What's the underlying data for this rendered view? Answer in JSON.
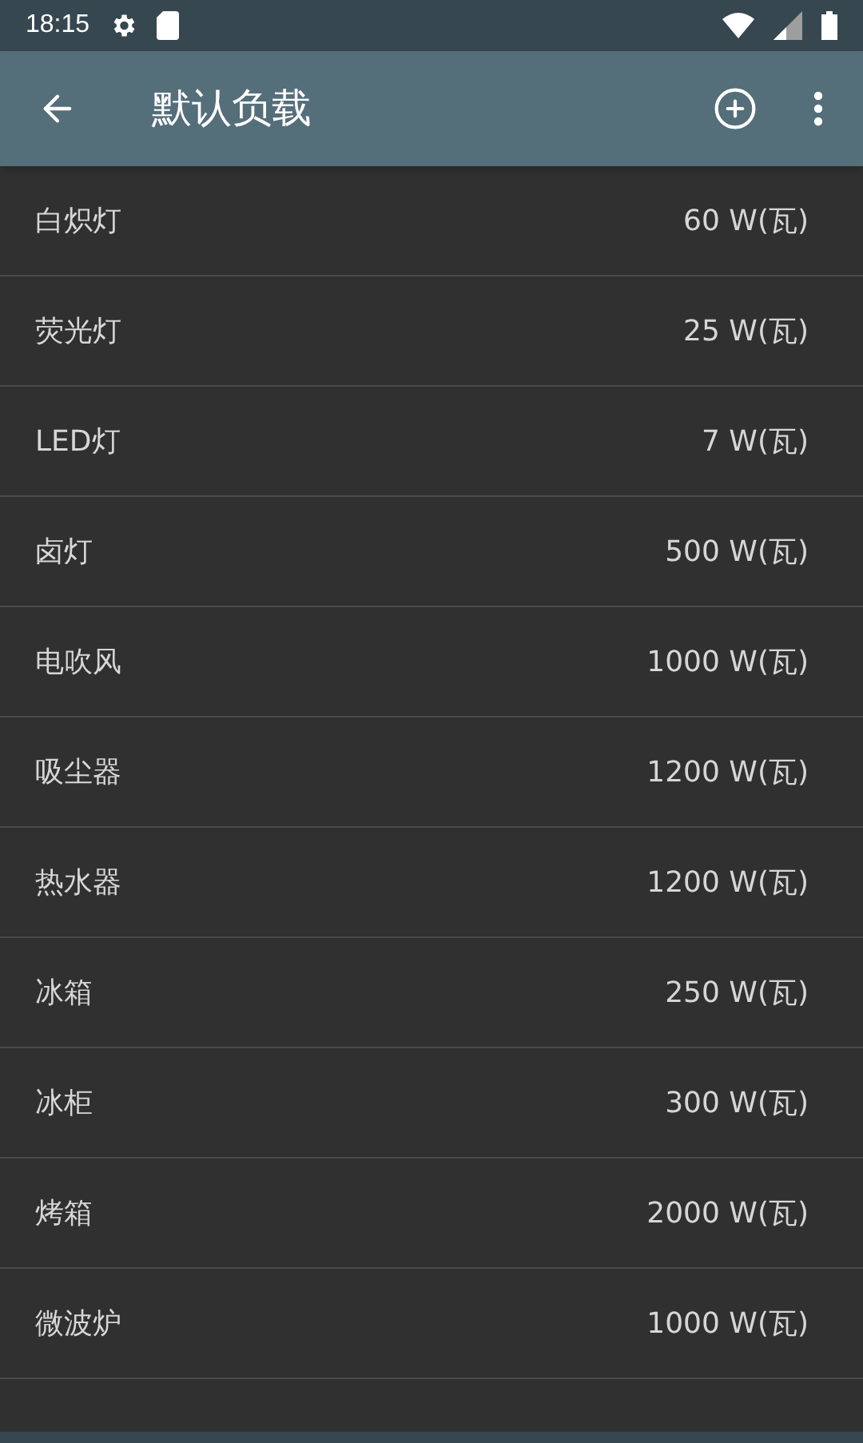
{
  "status_bar": {
    "time": "18:15"
  },
  "app_bar": {
    "title": "默认负载"
  },
  "loads": [
    {
      "name": "白炽灯",
      "power": "60 W(瓦)"
    },
    {
      "name": "荧光灯",
      "power": "25 W(瓦)"
    },
    {
      "name": "LED灯",
      "power": "7 W(瓦)"
    },
    {
      "name": "卤灯",
      "power": "500 W(瓦)"
    },
    {
      "name": "电吹风",
      "power": "1000 W(瓦)"
    },
    {
      "name": "吸尘器",
      "power": "1200 W(瓦)"
    },
    {
      "name": "热水器",
      "power": "1200 W(瓦)"
    },
    {
      "name": "冰箱",
      "power": "250 W(瓦)"
    },
    {
      "name": "冰柜",
      "power": "300 W(瓦)"
    },
    {
      "name": "烤箱",
      "power": "2000 W(瓦)"
    },
    {
      "name": "微波炉",
      "power": "1000 W(瓦)"
    }
  ]
}
